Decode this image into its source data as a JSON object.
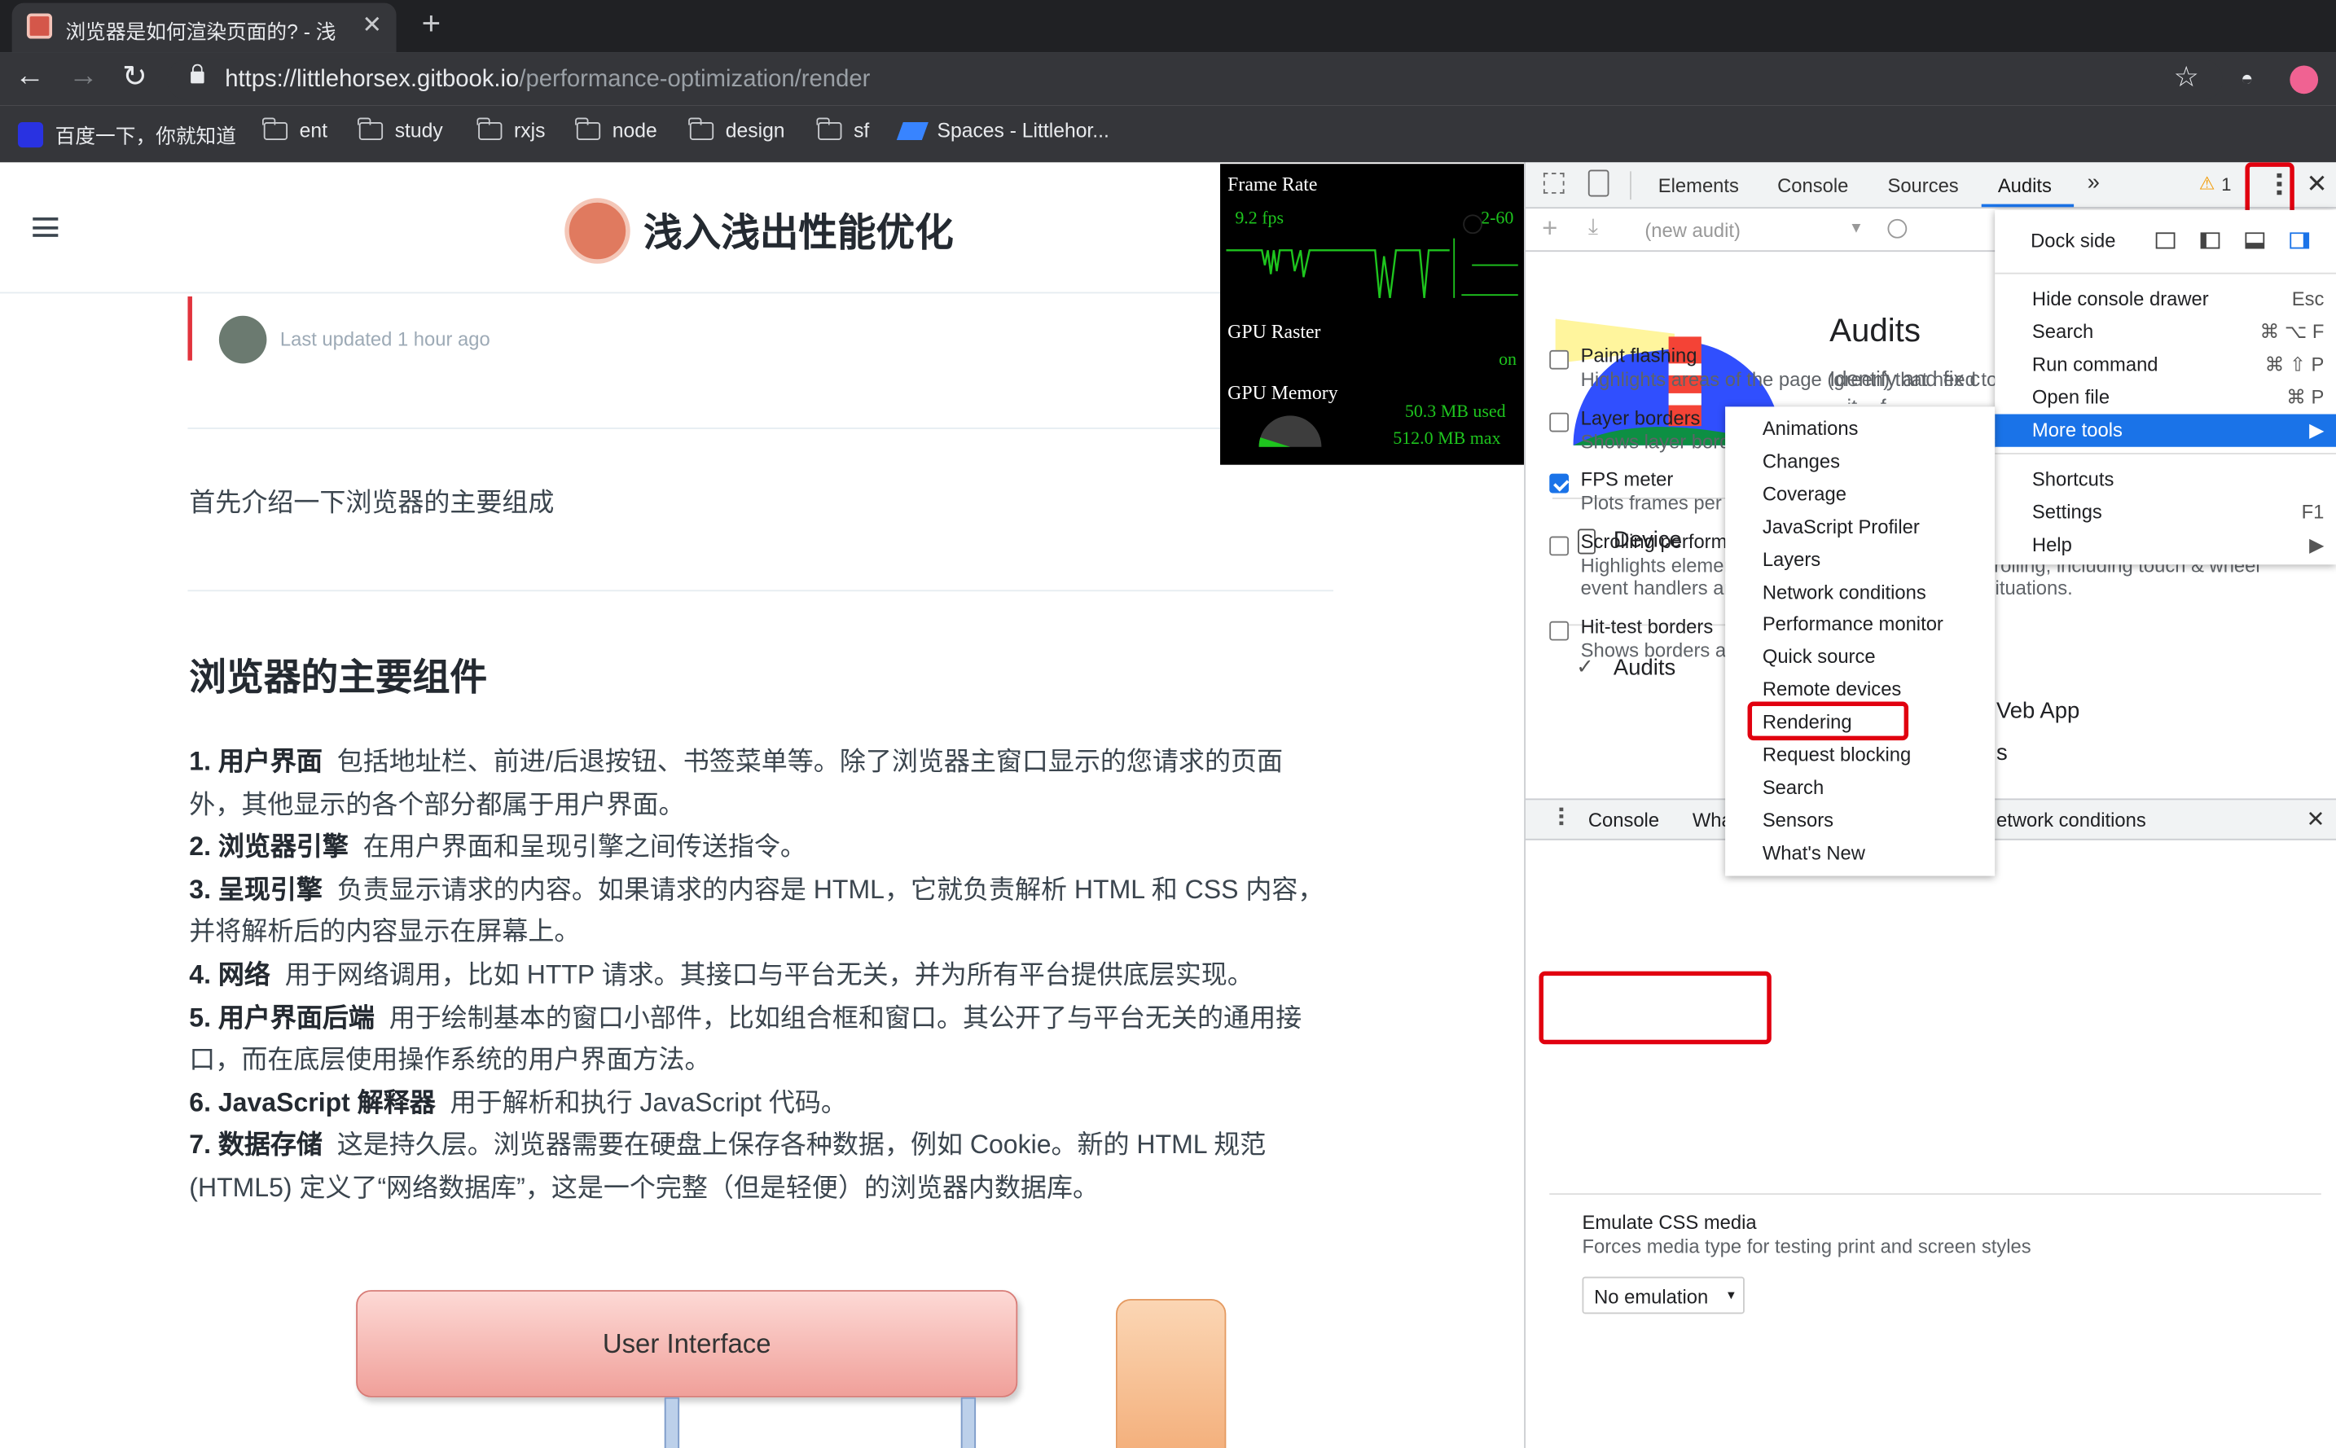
{
  "browser": {
    "tab_title": "浏览器是如何渲染页面的? - 浅",
    "url_host": "https://littlehorsex.gitbook.io",
    "url_path": "/performance-optimization/render",
    "bookmarks": [
      "百度一下，你就知道",
      "ent",
      "study",
      "rxjs",
      "node",
      "design",
      "sf",
      "Spaces - Littlehor..."
    ]
  },
  "page": {
    "site_title": "浅入浅出性能优化",
    "last_updated": "Last updated 1 hour ago",
    "intro": "首先介绍一下浏览器的主要组成",
    "heading": "浏览器的主要组件",
    "items": [
      {
        "label": "1. 用户界面",
        "text": "包括地址栏、前进/后退按钮、书签菜单等。除了浏览器主窗口显示的您请求的页面"
      },
      {
        "label": "",
        "text": "外，其他显示的各个部分都属于用户界面。"
      },
      {
        "label": "2. 浏览器引擎",
        "text": "在用户界面和呈现引擎之间传送指令。"
      },
      {
        "label": "3. 呈现引擎",
        "text": "负责显示请求的内容。如果请求的内容是 HTML，它就负责解析 HTML 和 CSS 内容，"
      },
      {
        "label": "",
        "text": "并将解析后的内容显示在屏幕上。"
      },
      {
        "label": "4. 网络",
        "text": "用于网络调用，比如 HTTP 请求。其接口与平台无关，并为所有平台提供底层实现。"
      },
      {
        "label": "5. 用户界面后端",
        "text": "用于绘制基本的窗口小部件，比如组合框和窗口。其公开了与平台无关的通用接"
      },
      {
        "label": "",
        "text": "口，而在底层使用操作系统的用户界面方法。"
      },
      {
        "label": "6. JavaScript 解释器",
        "text": "用于解析和执行 JavaScript 代码。"
      },
      {
        "label": "7. 数据存储",
        "text": "这是持久层。浏览器需要在硬盘上保存各种数据，例如 Cookie。新的 HTML 规范"
      },
      {
        "label": "",
        "text": "(HTML5) 定义了“网络数据库”，这是一个完整（但是轻便）的浏览器内数据库。"
      }
    ],
    "diagram_label": "User Interface"
  },
  "fps_meter": {
    "frame_rate_label": "Frame Rate",
    "fps": "9.2 fps",
    "range": "2-60",
    "gpu_raster_label": "GPU Raster",
    "gpu_raster_status": "on",
    "gpu_memory_label": "GPU Memory",
    "used": "50.3 MB used",
    "max": "512.0 MB max",
    "memory_fraction": 0.098
  },
  "devtools": {
    "tabs": [
      "Elements",
      "Console",
      "Sources",
      "Audits"
    ],
    "active_tab": "Audits",
    "more_tabs": "»",
    "warning_count": "1",
    "new_audit": "(new audit)",
    "audits_title": "Audits",
    "audits_desc": "Identify and fix c",
    "audits_desc2": "...it... f",
    "device_label": "Device",
    "audits_check_label": "Audits",
    "web_app_fragment": "Veb App",
    "s_fragment": "s",
    "drawer_tabs": [
      "Console",
      "Wha",
      "etwork conditions"
    ],
    "rendering_options": [
      {
        "title": "Paint flashing",
        "desc": "Highlights areas of the page (green) that need to be repainted",
        "checked": false
      },
      {
        "title": "Layer borders",
        "desc": "Shows layer borders (orange/olive) and tiles (cyan)",
        "checked": false
      },
      {
        "title": "FPS meter",
        "desc": "Plots frames per second, frame rate distribution, and GPU memory",
        "checked": true
      },
      {
        "title": "Scrolling performance issues",
        "desc": "Highlights elements (teal) that can slow down scrolling, including touch & wheel",
        "desc2": "event handlers and other main-thread scrolling situations.",
        "checked": false
      },
      {
        "title": "Hit-test borders",
        "desc": "Shows borders around hit-test regions",
        "checked": false
      }
    ],
    "emulate_title": "Emulate CSS media",
    "emulate_desc": "Forces media type for testing print and screen styles",
    "emulate_value": "No emulation"
  },
  "main_menu": {
    "dock_side": "Dock side",
    "items": [
      {
        "label": "Hide console drawer",
        "shortcut": "Esc"
      },
      {
        "label": "Search",
        "shortcut": "⌘ ⌥ F"
      },
      {
        "label": "Run command",
        "shortcut": "⌘ ⇧ P"
      },
      {
        "label": "Open file",
        "shortcut": "⌘ P"
      },
      {
        "label": "More tools",
        "shortcut": "▶"
      },
      {
        "label": "Shortcuts",
        "shortcut": ""
      },
      {
        "label": "Settings",
        "shortcut": "F1"
      },
      {
        "label": "Help",
        "shortcut": "▶"
      }
    ],
    "highlighted": "More tools"
  },
  "more_tools_menu": {
    "items": [
      "Animations",
      "Changes",
      "Coverage",
      "JavaScript Profiler",
      "Layers",
      "Network conditions",
      "Performance monitor",
      "Quick source",
      "Remote devices",
      "Rendering",
      "Request blocking",
      "Search",
      "Sensors",
      "What's New"
    ],
    "boxed": "Rendering"
  },
  "colors": {
    "accent": "#1a73e8",
    "highlight_red": "#e1000f",
    "menu_highlight": "#1a73e8",
    "fps_green": "#1ec51e"
  }
}
